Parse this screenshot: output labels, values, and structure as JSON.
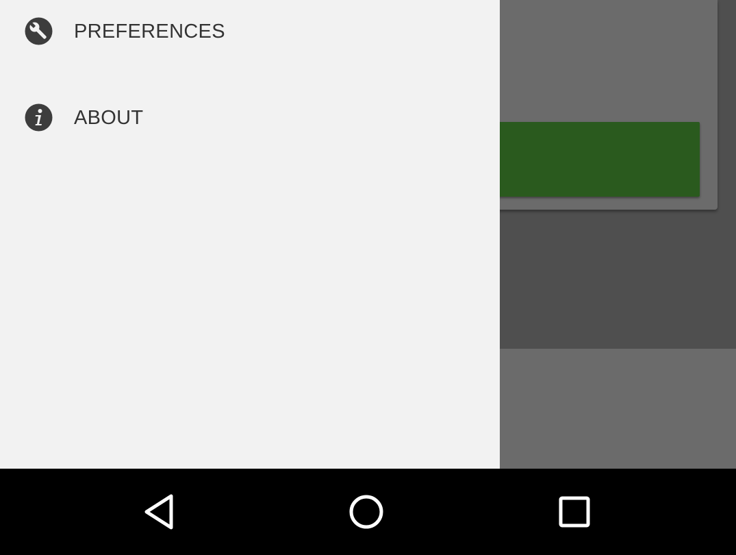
{
  "drawer": {
    "items": [
      {
        "label": "PREFERENCES",
        "icon": "preferences-wrench-icon"
      },
      {
        "label": "ABOUT",
        "icon": "info-icon"
      }
    ]
  },
  "navbar": {
    "back": {
      "icon": "back-triangle-icon"
    },
    "home": {
      "icon": "home-circle-icon"
    },
    "recents": {
      "icon": "recents-square-icon"
    }
  },
  "colors": {
    "drawer_background": "#f2f2f2",
    "scrim": "#4f4f4f",
    "app_button_green": "#2a5a1e",
    "navbar_background": "#000000",
    "icon_color": "#3d3d3d"
  }
}
